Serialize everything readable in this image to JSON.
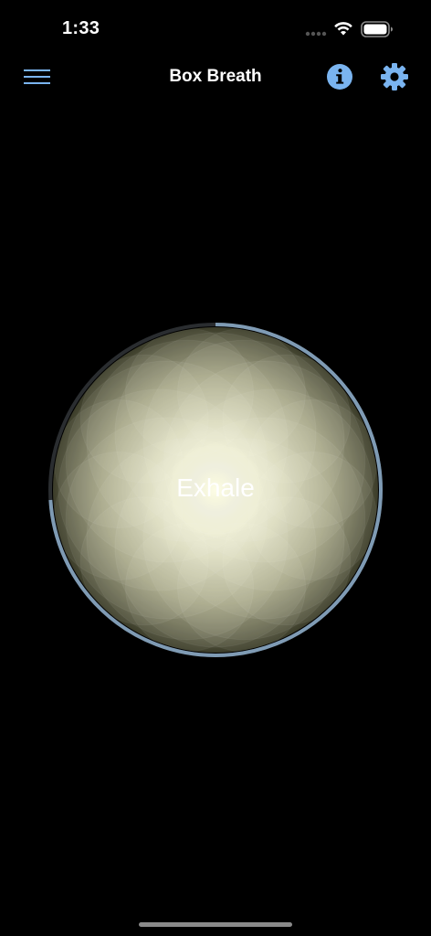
{
  "status_bar": {
    "time": "1:33",
    "icons": [
      "signal-dots-icon",
      "wifi-icon",
      "battery-icon"
    ]
  },
  "nav": {
    "title": "Box Breath",
    "menu_icon": "hamburger-menu-icon",
    "info_icon": "info-icon",
    "settings_icon": "gear-icon"
  },
  "breath": {
    "phase": "Exhale",
    "progress": 0.74,
    "progress_color": "#7f9bb4",
    "track_color": "#2a2d30"
  },
  "colors": {
    "accent": "#7ab4f0",
    "background": "#000000",
    "flower_center": "#fbfbe0",
    "flower_edge": "#3a3b28"
  }
}
